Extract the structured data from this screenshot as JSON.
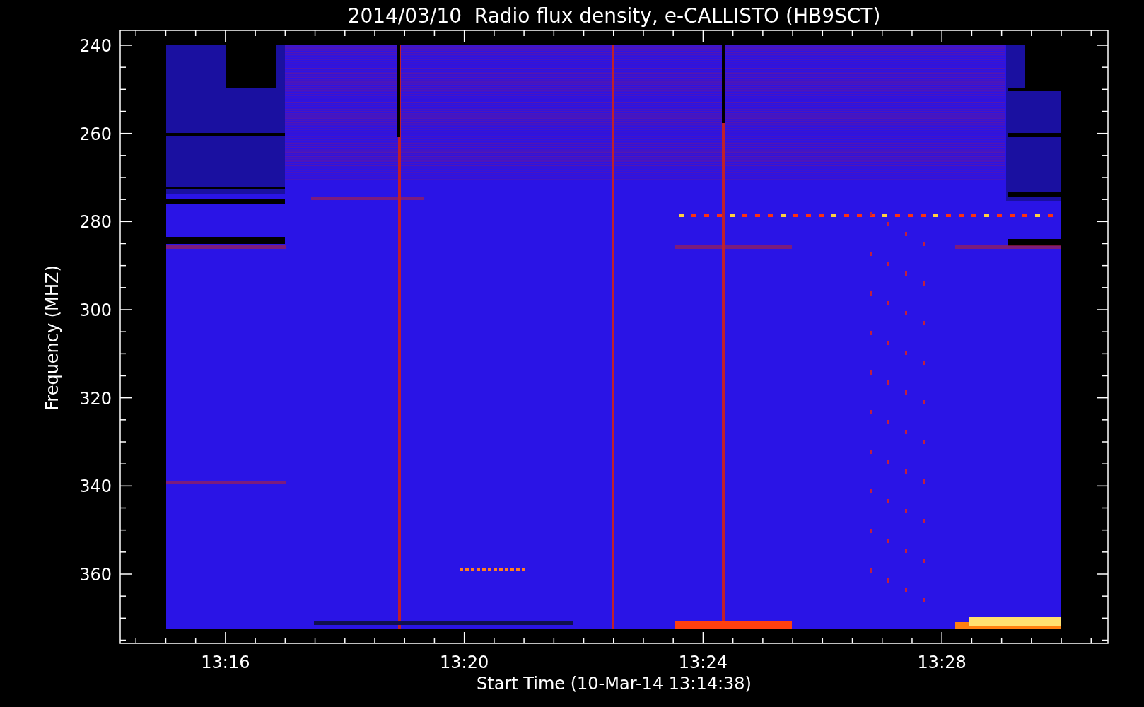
{
  "title": "2014/03/10  Radio flux density, e-CALLISTO (HB9SCT)",
  "y_axis": {
    "label": "Frequency (MHZ)",
    "ticks": [
      "240",
      "260",
      "280",
      "300",
      "320",
      "340",
      "360"
    ]
  },
  "x_axis": {
    "label": "Start Time (10-Mar-14 13:14:38)",
    "ticks": [
      "13:16",
      "13:20",
      "13:24",
      "13:28"
    ]
  }
}
